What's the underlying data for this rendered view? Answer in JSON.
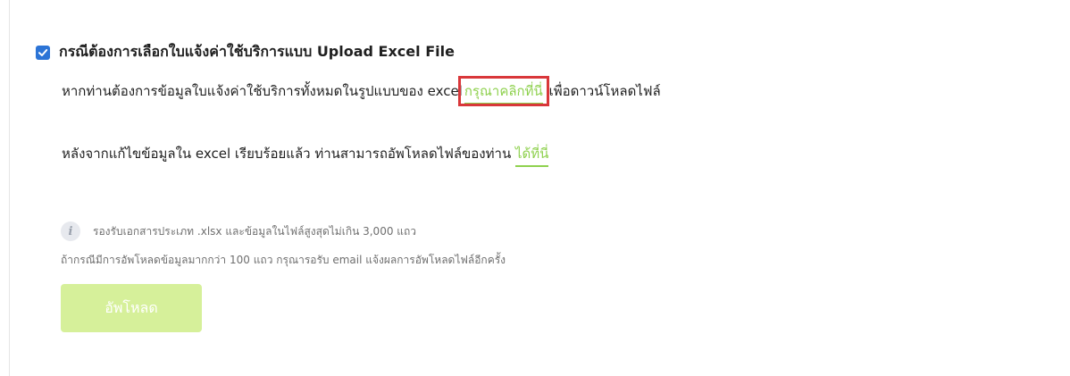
{
  "upload_section": {
    "checkbox_checked": true,
    "title": "กรณีต้องการเลือกใบแจ้งค่าใช้บริการแบบ Upload Excel File",
    "download_text_before": "หากท่านต้องการข้อมูลใบแจ้งค่าใช้บริการทั้งหมดในรูปแบบของ excel",
    "download_link": "กรุณาคลิกที่นี่",
    "download_text_after": "เพื่อดาวน์โหลดไฟล์",
    "upload_text": "หลังจากแก้ไขข้อมูลใน excel เรียบร้อยแล้ว ท่านสามารถอัพโหลดไฟล์ของท่าน",
    "upload_link": "ได้ที่นี่",
    "info_icon_glyph": "i",
    "note_line1": "รองรับเอกสารประเภท .xlsx และข้อมูลในไฟล์สูงสุดไม่เกิน 3,000 แถว",
    "note_line2": "ถ้ากรณีมีการอัพโหลดข้อมูลมากกว่า 100 แถว กรุณารอรับ email แจ้งผลการอัพโหลดไฟล์อีกครั้ง",
    "upload_button_label": "อัพโหลด"
  },
  "colors": {
    "checkbox": "#2c74d6",
    "link": "#8fd14f",
    "highlight_box": "#d9373a",
    "upload_button_bg": "#d6f09a",
    "note_text": "#6f6f6f"
  }
}
